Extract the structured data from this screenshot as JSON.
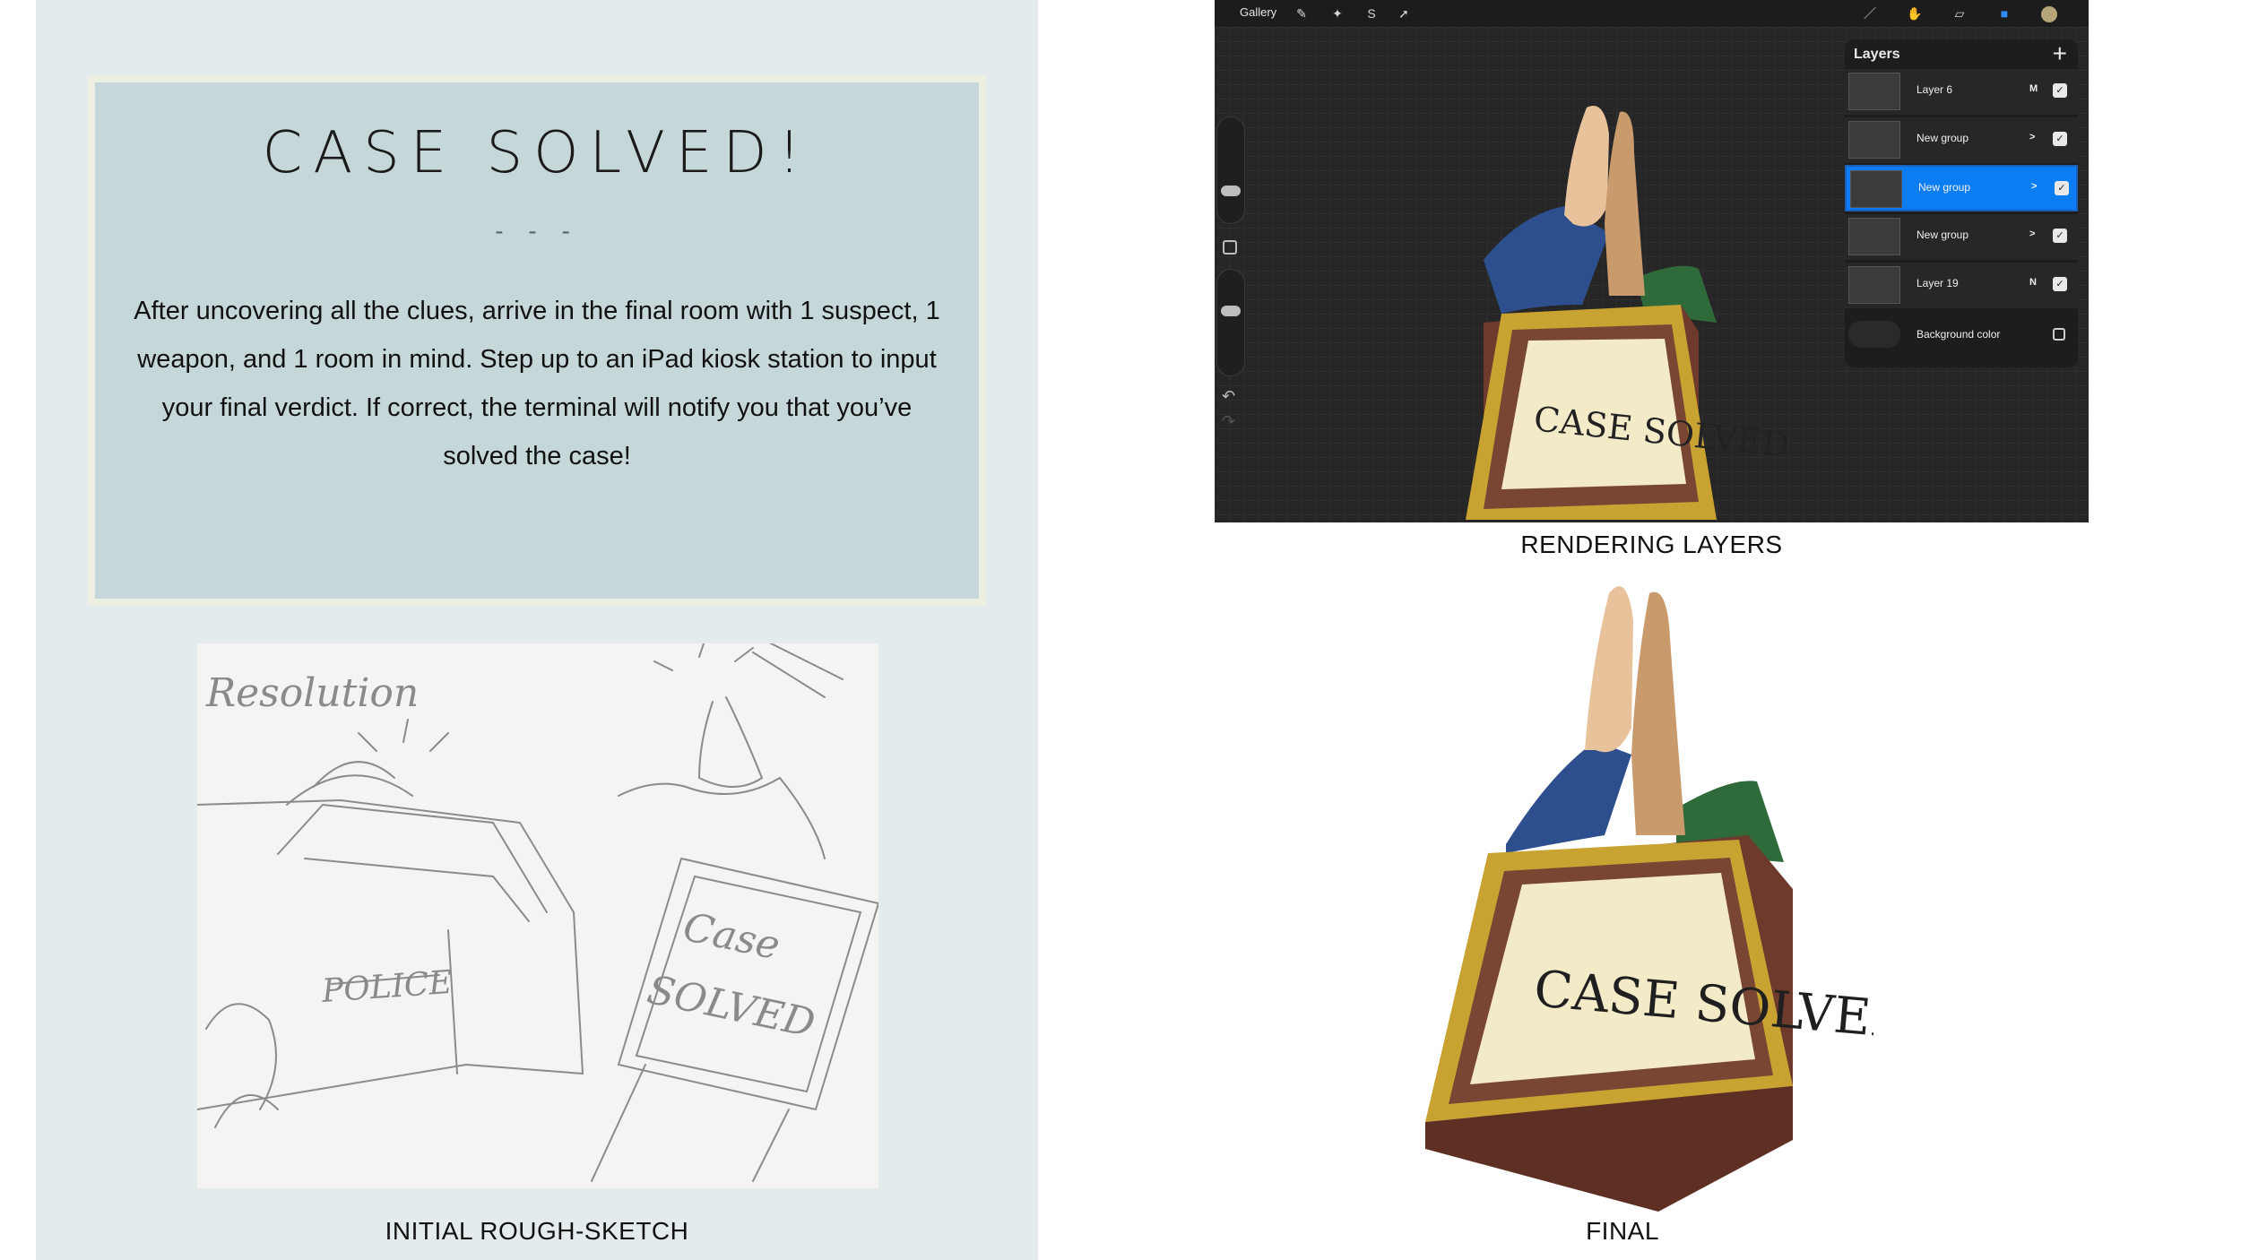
{
  "case_card": {
    "title": "CASE SOLVED!",
    "divider": "- - -",
    "body": "After uncovering all the clues, arrive in the final room with 1 suspect, 1 weapon, and 1 room in mind. Step up to an iPad kiosk station to input your final verdict. If correct, the terminal will notify you that you’ve solved the case!"
  },
  "sketch": {
    "heading": "Resolution",
    "police_text": "POLICE",
    "sign_line1": "Case",
    "sign_line2": "SOLVED",
    "caption": "INITIAL ROUGH-SKETCH"
  },
  "procreate": {
    "gallery_label": "Gallery",
    "layers_title": "Layers",
    "layers": [
      {
        "name": "Layer 6",
        "mode": "M",
        "checked": true,
        "selected": false
      },
      {
        "name": "New group",
        "mode": ">",
        "checked": true,
        "selected": false
      },
      {
        "name": "New group",
        "mode": ">",
        "checked": true,
        "selected": true
      },
      {
        "name": "New group",
        "mode": ">",
        "checked": true,
        "selected": false
      },
      {
        "name": "Layer 19",
        "mode": "N",
        "checked": true,
        "selected": false
      }
    ],
    "background_label": "Background color",
    "caption": "RENDERING LAYERS"
  },
  "artwork": {
    "sign_text": "CASE SOLVED",
    "caption": "FINAL"
  },
  "colors": {
    "panel_bg": "#e3ebec",
    "card_bg": "#c6d7da",
    "card_border": "#eeefe3",
    "selected_layer": "#0a7df2",
    "sleeve_blue": "#2d4f8e",
    "sleeve_green": "#2f6b3a",
    "kiosk_brown": "#6e3a2c",
    "kiosk_gold": "#c9a332",
    "screen_cream": "#f3eac8"
  }
}
